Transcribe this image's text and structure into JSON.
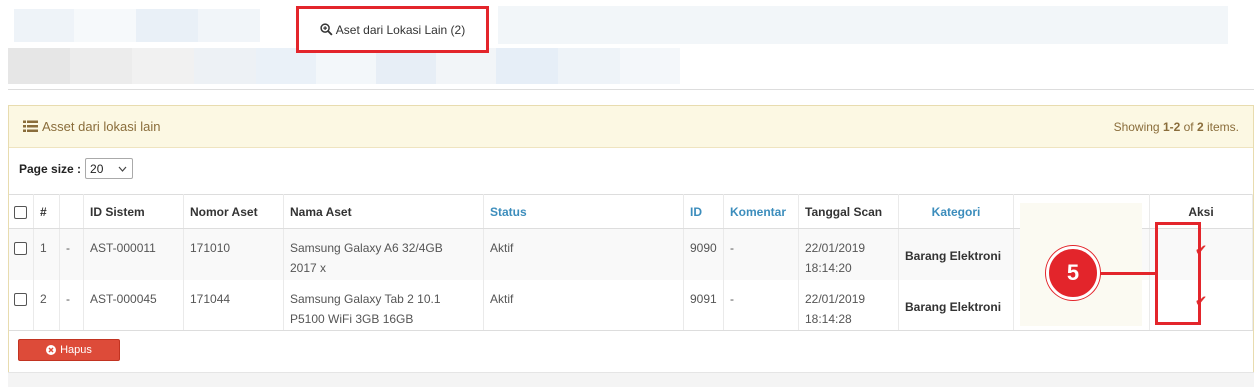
{
  "top_tab": {
    "label": "Aset dari Lokasi Lain (2)",
    "icon": "zoom-in-icon"
  },
  "panel": {
    "icon": "list-icon",
    "title": "Asset dari lokasi lain",
    "summary_prefix": "Showing ",
    "summary_range": "1-2",
    "summary_of": " of ",
    "summary_total": "2",
    "summary_suffix": " items."
  },
  "page_size": {
    "label": "Page size :",
    "value": "20"
  },
  "table": {
    "headers": {
      "no": "#",
      "id_sistem": "ID Sistem",
      "nomor_aset": "Nomor Aset",
      "nama_aset": "Nama Aset",
      "status": "Status",
      "id": "ID",
      "komentar": "Komentar",
      "tanggal_scan": "Tanggal Scan",
      "kategori": "Kategori",
      "aksi": "Aksi"
    },
    "rows": [
      {
        "no": "1",
        "dash": "-",
        "id_sistem": "AST-000011",
        "nomor_aset": "171010",
        "nama_aset_1": "Samsung Galaxy A6 32/4GB",
        "nama_aset_2": "2017 x",
        "status": "Aktif",
        "id": "9090",
        "komentar": "-",
        "tanggal": "22/01/2019",
        "jam": "18:14:20",
        "kategori": "Barang Elektroni",
        "aksi": "✔"
      },
      {
        "no": "2",
        "dash": "-",
        "id_sistem": "AST-000045",
        "nomor_aset": "171044",
        "nama_aset_1": "Samsung Galaxy Tab 2 10.1",
        "nama_aset_2": "P5100 WiFi 3GB 16GB",
        "status": "Aktif",
        "id": "9091",
        "komentar": "-",
        "tanggal": "22/01/2019",
        "jam": "18:14:28",
        "kategori": "Barang Elektroni",
        "aksi": "✔"
      }
    ]
  },
  "annotation": {
    "number": "5"
  },
  "delete_button": {
    "label": "Hapus",
    "icon": "times-circle-icon"
  },
  "colors": {
    "accent_red": "#e3252b",
    "link_blue": "#3c8dbc",
    "panel_bg": "#fcf8e3",
    "danger": "#dd4b39"
  }
}
